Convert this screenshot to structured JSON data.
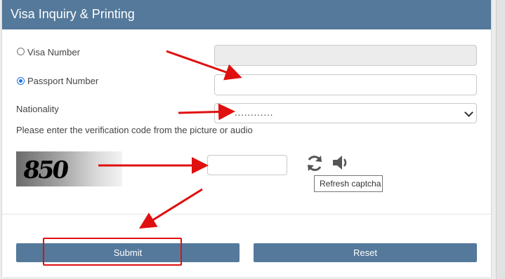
{
  "header": {
    "title": "Visa Inquiry & Printing"
  },
  "form": {
    "visa_number_label": "Visa Number",
    "passport_number_label": "Passport Number",
    "nationality_label": "Nationality",
    "nationality_value": "............",
    "verification_note": "Please enter the verification code from the picture or audio",
    "captcha_code": "850",
    "visa_number_selected": false,
    "passport_number_selected": true
  },
  "tooltip": {
    "refresh": "Refresh captcha"
  },
  "buttons": {
    "submit": "Submit",
    "reset": "Reset"
  },
  "icons": {
    "refresh": "refresh-icon",
    "audio": "speaker-icon",
    "dropdown": "chevron-down-icon"
  },
  "colors": {
    "header": "#54799b",
    "button": "#54799b",
    "annotation": "#e01010"
  }
}
